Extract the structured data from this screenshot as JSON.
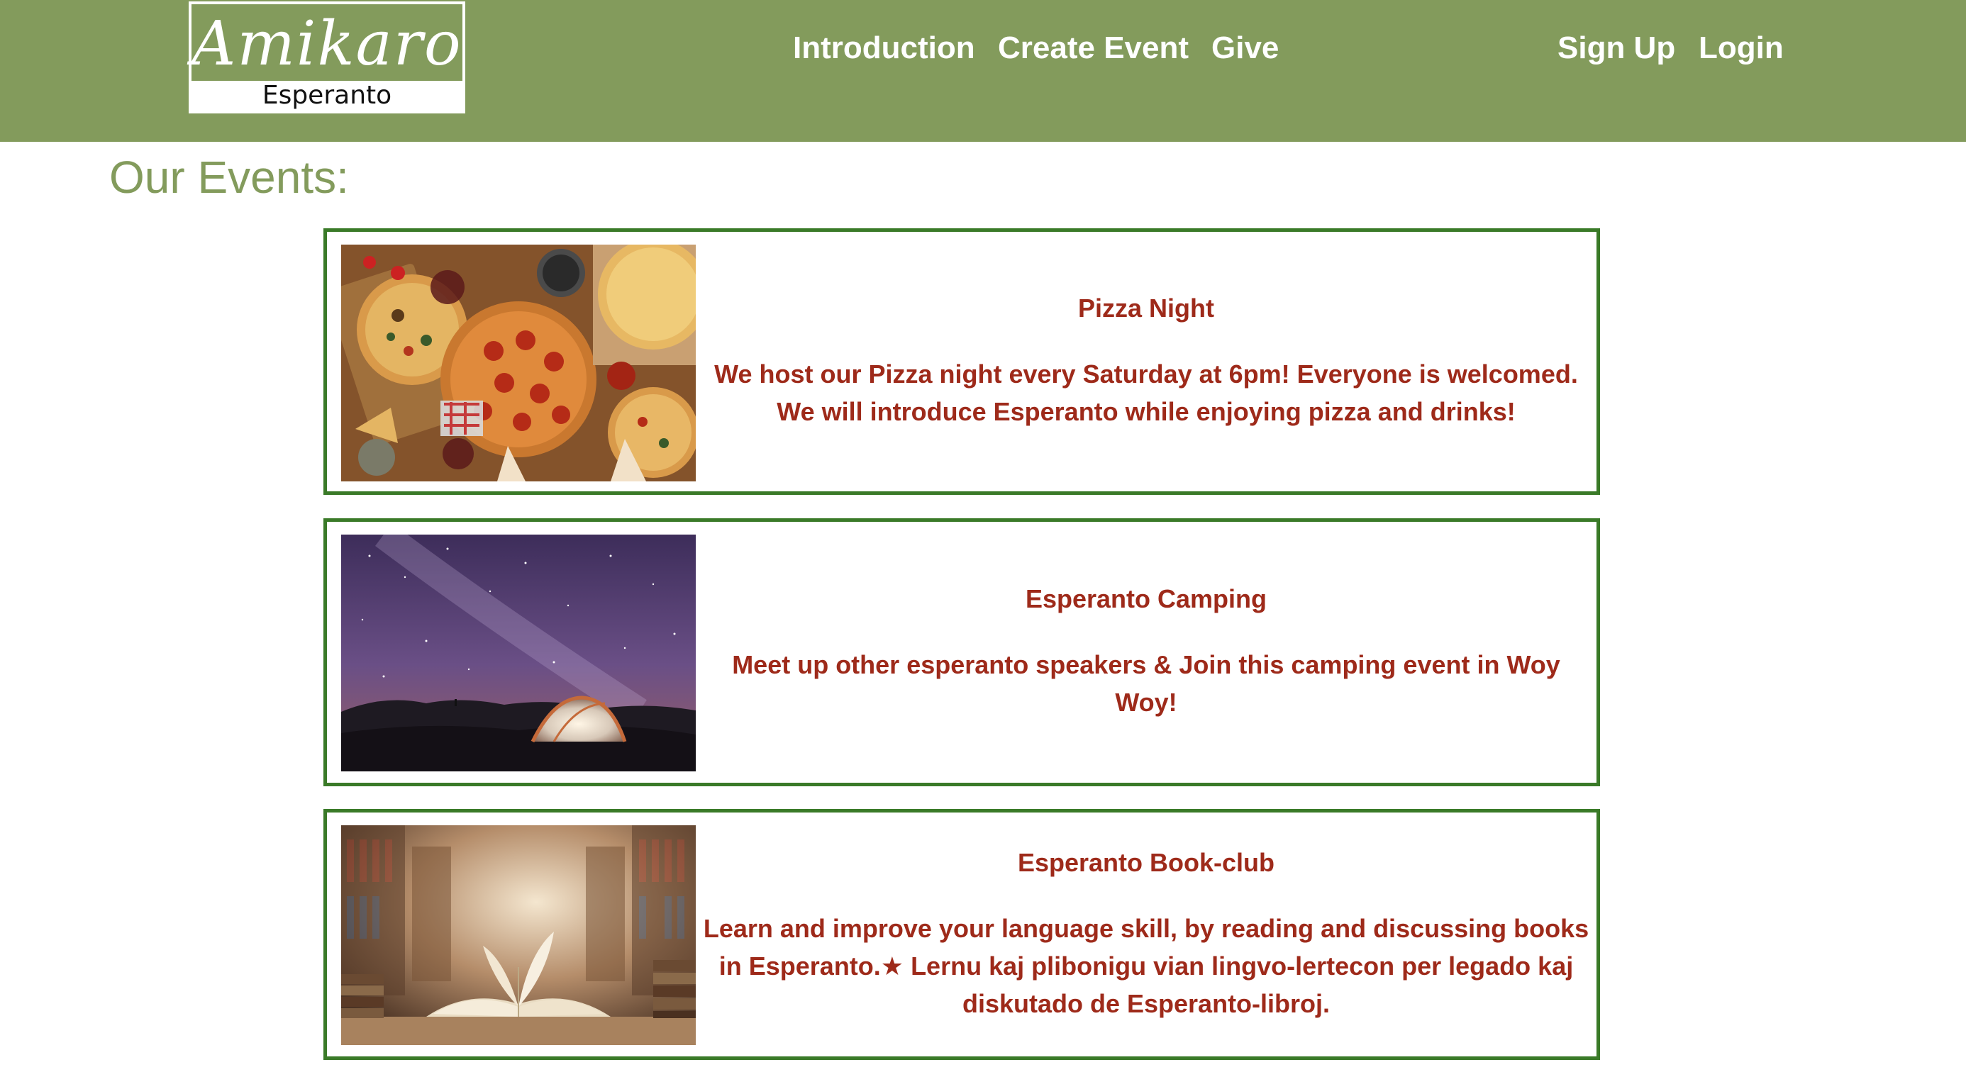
{
  "header": {
    "logo": {
      "brand": "Amikaro",
      "subtitle": "Esperanto"
    },
    "nav": {
      "introduction": "Introduction",
      "create_event": "Create Event",
      "give": "Give",
      "sign_up": "Sign Up",
      "login": "Login"
    },
    "background_color": "#839b5c"
  },
  "main": {
    "heading": "Our Events:",
    "events": [
      {
        "title": "Pizza Night",
        "description": "We host our Pizza night every Saturday at 6pm! Everyone is welcomed. We will introduce Esperanto while enjoying pizza and drinks!",
        "image_icon": "pizza-photo"
      },
      {
        "title": "Esperanto Camping",
        "description": "Meet up other esperanto speakers & Join this camping event in Woy Woy!",
        "image_icon": "camping-night-photo"
      },
      {
        "title": "Esperanto Book-club",
        "description": "Learn and improve your language skill, by reading and discussing books in Esperanto.★ Lernu kaj plibonigu vian lingvo-lertecon per legado kaj diskutado de Esperanto-libroj.",
        "image_icon": "books-library-photo"
      }
    ]
  },
  "colors": {
    "accent_green": "#839b5c",
    "card_border": "#3a7a28",
    "event_text": "#9e2a1a"
  }
}
